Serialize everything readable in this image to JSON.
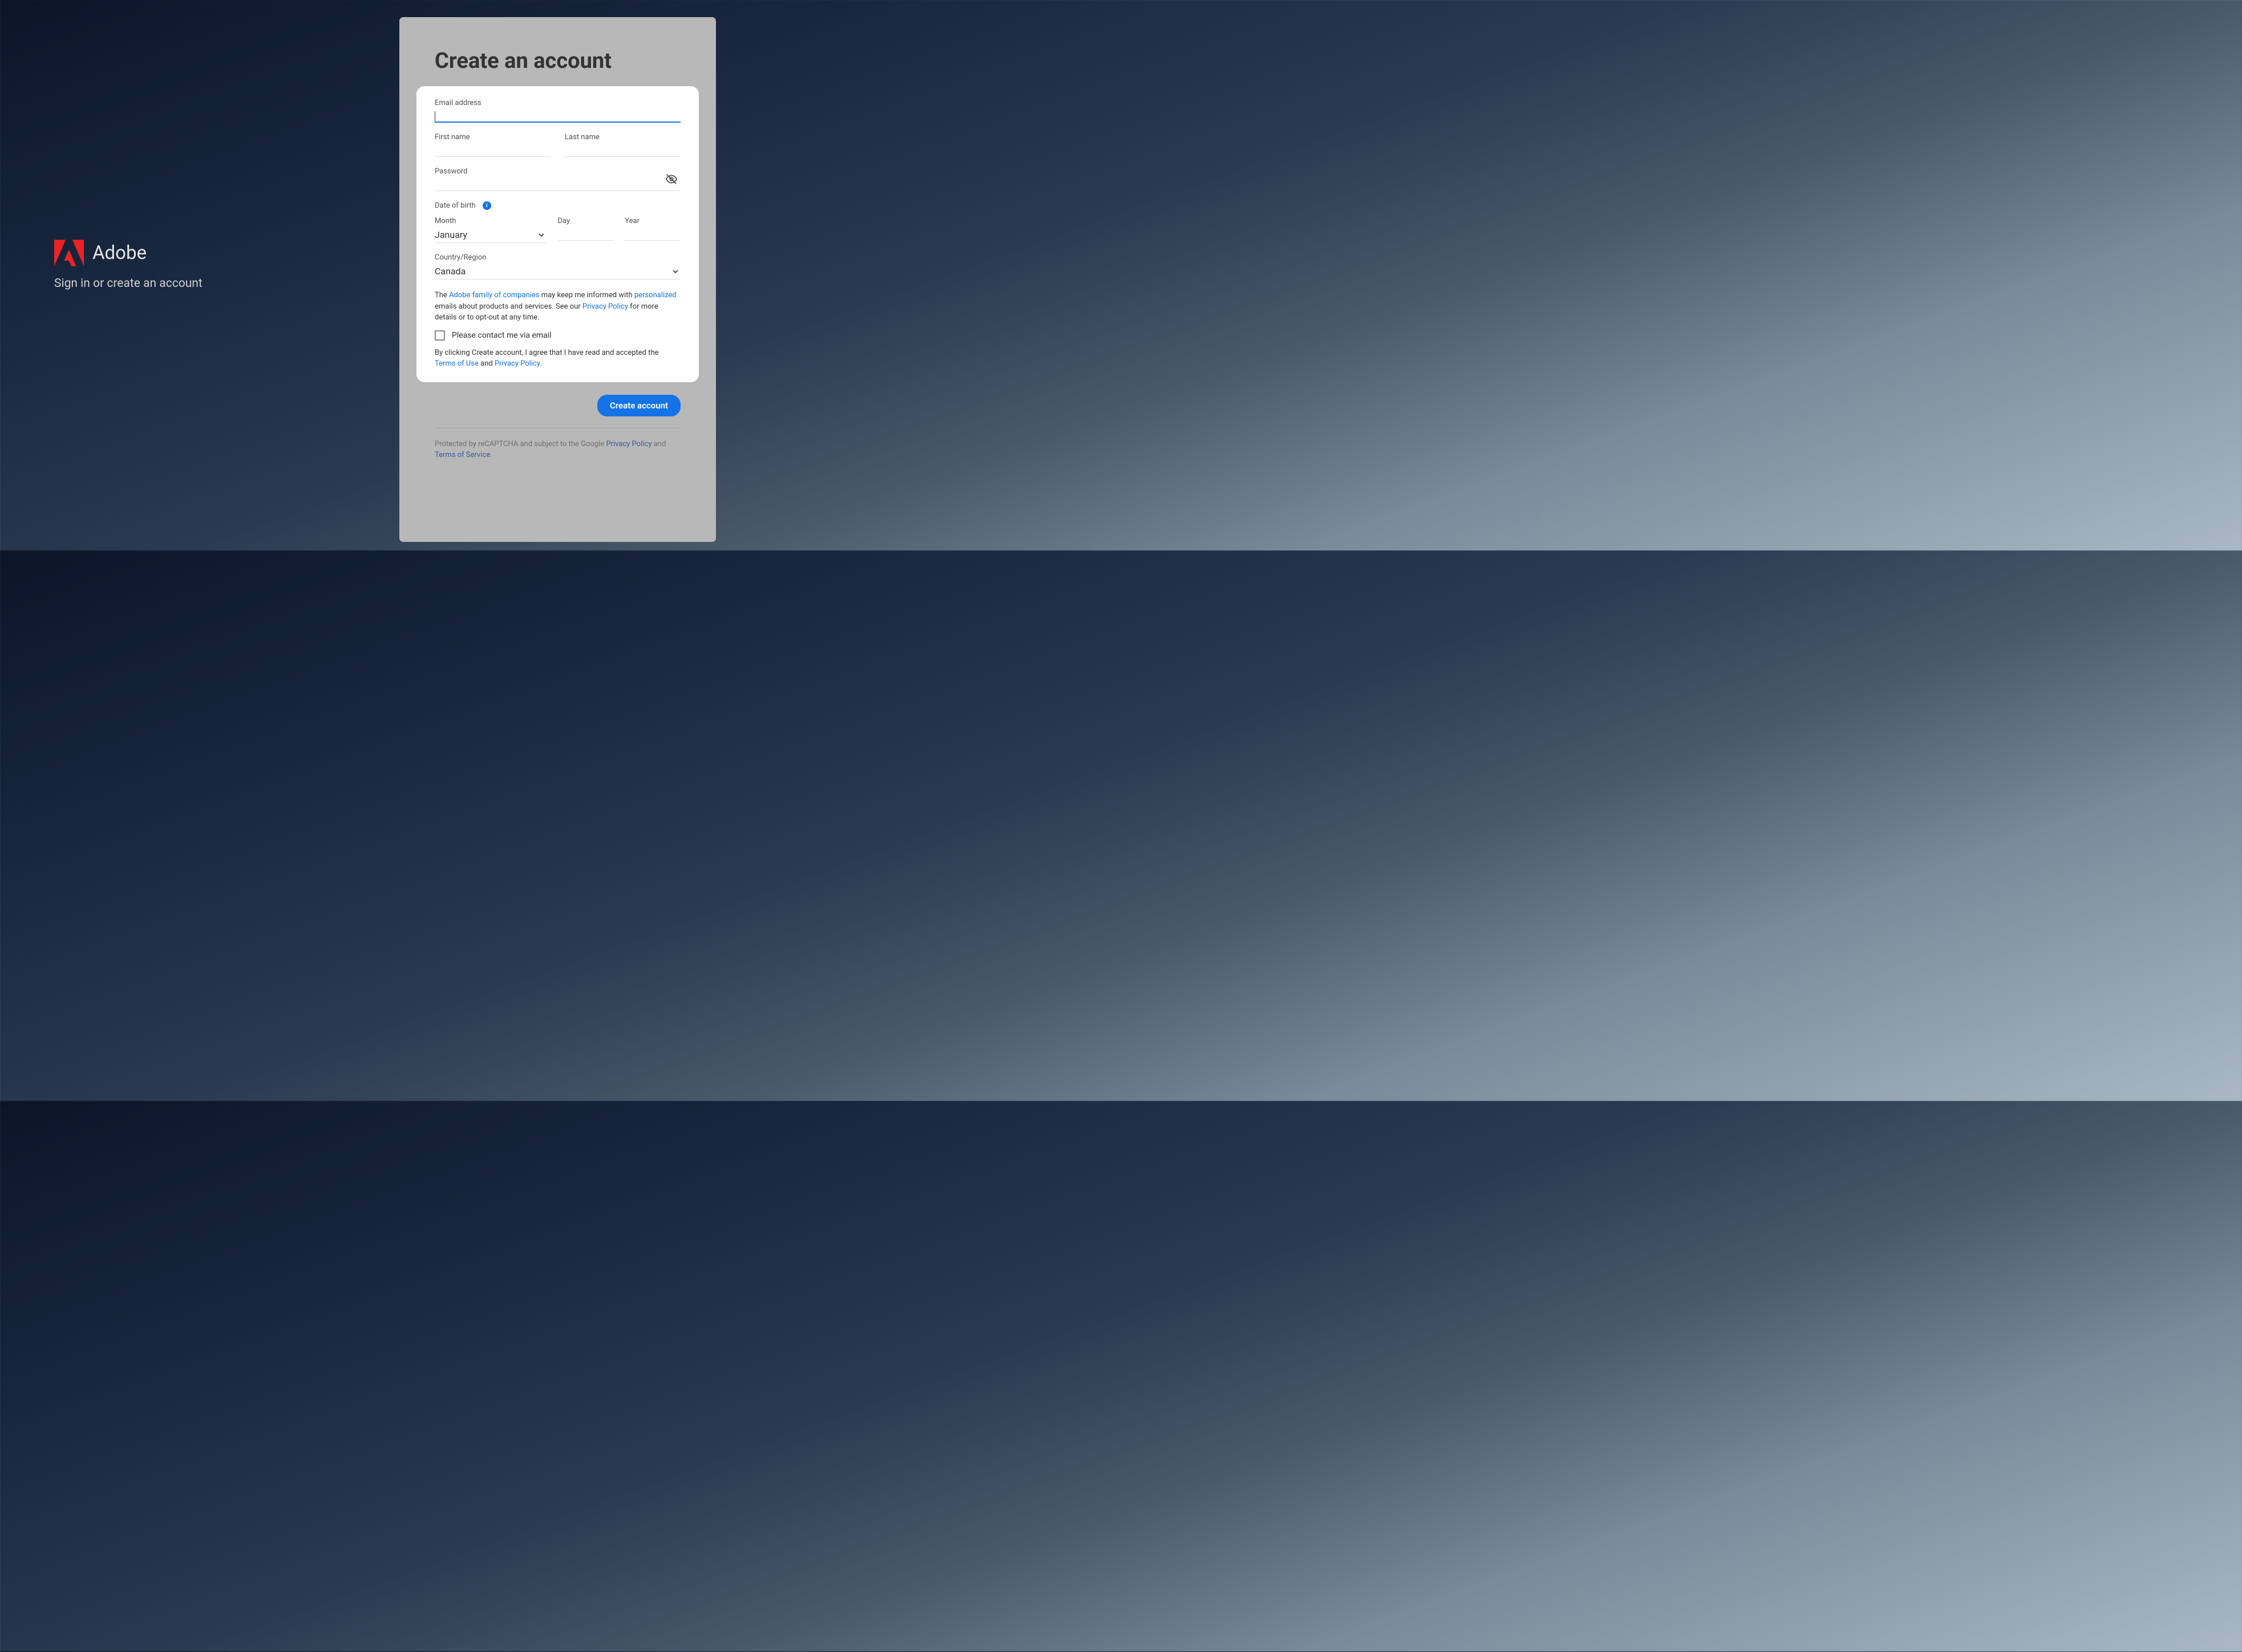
{
  "left": {
    "brand": "Adobe",
    "subtitle": "Sign in or create an account"
  },
  "panel": {
    "title": "Create an account",
    "email_label": "Email address",
    "firstname_label": "First name",
    "lastname_label": "Last name",
    "password_label": "Password",
    "dob_label": "Date of birth",
    "month_label": "Month",
    "day_label": "Day",
    "year_label": "Year",
    "month_value": "January",
    "country_label": "Country/Region",
    "country_value": "Canada",
    "consent": {
      "prefix": "The ",
      "link1": "Adobe family of companies",
      "mid1": " may keep me informed with ",
      "link2": "personalized",
      "mid2": " emails about products and services. See our ",
      "link3": "Privacy Policy",
      "suffix": " for more details or to opt-out at any time."
    },
    "checkbox_label": "Please contact me via email",
    "terms": {
      "prefix": "By clicking Create account, I agree that I have read and accepted the ",
      "link1": "Terms of Use",
      "mid": " and ",
      "link2": "Privacy Policy",
      "suffix": "."
    },
    "create_button": "Create account",
    "footer": {
      "prefix": "Protected by reCAPTCHA and subject to the Google ",
      "link1": "Privacy Policy",
      "mid": " and ",
      "link2": "Terms of Service",
      "suffix": "."
    }
  }
}
